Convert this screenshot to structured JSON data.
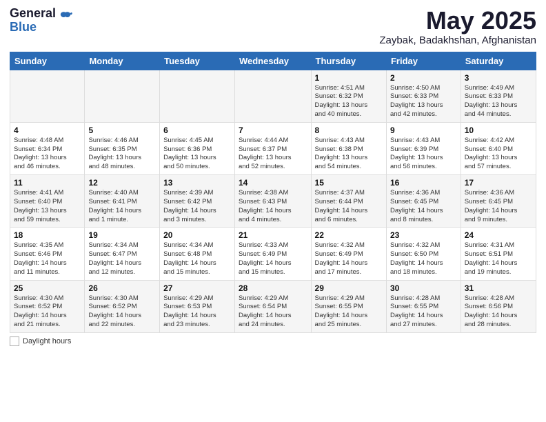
{
  "header": {
    "logo_general": "General",
    "logo_blue": "Blue",
    "month_title": "May 2025",
    "location": "Zaybak, Badakhshan, Afghanistan"
  },
  "weekdays": [
    "Sunday",
    "Monday",
    "Tuesday",
    "Wednesday",
    "Thursday",
    "Friday",
    "Saturday"
  ],
  "weeks": [
    [
      {
        "day": "",
        "info": ""
      },
      {
        "day": "",
        "info": ""
      },
      {
        "day": "",
        "info": ""
      },
      {
        "day": "",
        "info": ""
      },
      {
        "day": "1",
        "info": "Sunrise: 4:51 AM\nSunset: 6:32 PM\nDaylight: 13 hours\nand 40 minutes."
      },
      {
        "day": "2",
        "info": "Sunrise: 4:50 AM\nSunset: 6:33 PM\nDaylight: 13 hours\nand 42 minutes."
      },
      {
        "day": "3",
        "info": "Sunrise: 4:49 AM\nSunset: 6:33 PM\nDaylight: 13 hours\nand 44 minutes."
      }
    ],
    [
      {
        "day": "4",
        "info": "Sunrise: 4:48 AM\nSunset: 6:34 PM\nDaylight: 13 hours\nand 46 minutes."
      },
      {
        "day": "5",
        "info": "Sunrise: 4:46 AM\nSunset: 6:35 PM\nDaylight: 13 hours\nand 48 minutes."
      },
      {
        "day": "6",
        "info": "Sunrise: 4:45 AM\nSunset: 6:36 PM\nDaylight: 13 hours\nand 50 minutes."
      },
      {
        "day": "7",
        "info": "Sunrise: 4:44 AM\nSunset: 6:37 PM\nDaylight: 13 hours\nand 52 minutes."
      },
      {
        "day": "8",
        "info": "Sunrise: 4:43 AM\nSunset: 6:38 PM\nDaylight: 13 hours\nand 54 minutes."
      },
      {
        "day": "9",
        "info": "Sunrise: 4:43 AM\nSunset: 6:39 PM\nDaylight: 13 hours\nand 56 minutes."
      },
      {
        "day": "10",
        "info": "Sunrise: 4:42 AM\nSunset: 6:40 PM\nDaylight: 13 hours\nand 57 minutes."
      }
    ],
    [
      {
        "day": "11",
        "info": "Sunrise: 4:41 AM\nSunset: 6:40 PM\nDaylight: 13 hours\nand 59 minutes."
      },
      {
        "day": "12",
        "info": "Sunrise: 4:40 AM\nSunset: 6:41 PM\nDaylight: 14 hours\nand 1 minute."
      },
      {
        "day": "13",
        "info": "Sunrise: 4:39 AM\nSunset: 6:42 PM\nDaylight: 14 hours\nand 3 minutes."
      },
      {
        "day": "14",
        "info": "Sunrise: 4:38 AM\nSunset: 6:43 PM\nDaylight: 14 hours\nand 4 minutes."
      },
      {
        "day": "15",
        "info": "Sunrise: 4:37 AM\nSunset: 6:44 PM\nDaylight: 14 hours\nand 6 minutes."
      },
      {
        "day": "16",
        "info": "Sunrise: 4:36 AM\nSunset: 6:45 PM\nDaylight: 14 hours\nand 8 minutes."
      },
      {
        "day": "17",
        "info": "Sunrise: 4:36 AM\nSunset: 6:45 PM\nDaylight: 14 hours\nand 9 minutes."
      }
    ],
    [
      {
        "day": "18",
        "info": "Sunrise: 4:35 AM\nSunset: 6:46 PM\nDaylight: 14 hours\nand 11 minutes."
      },
      {
        "day": "19",
        "info": "Sunrise: 4:34 AM\nSunset: 6:47 PM\nDaylight: 14 hours\nand 12 minutes."
      },
      {
        "day": "20",
        "info": "Sunrise: 4:34 AM\nSunset: 6:48 PM\nDaylight: 14 hours\nand 15 minutes."
      },
      {
        "day": "21",
        "info": "Sunrise: 4:33 AM\nSunset: 6:49 PM\nDaylight: 14 hours\nand 15 minutes."
      },
      {
        "day": "22",
        "info": "Sunrise: 4:32 AM\nSunset: 6:49 PM\nDaylight: 14 hours\nand 17 minutes."
      },
      {
        "day": "23",
        "info": "Sunrise: 4:32 AM\nSunset: 6:50 PM\nDaylight: 14 hours\nand 18 minutes."
      },
      {
        "day": "24",
        "info": "Sunrise: 4:31 AM\nSunset: 6:51 PM\nDaylight: 14 hours\nand 19 minutes."
      }
    ],
    [
      {
        "day": "25",
        "info": "Sunrise: 4:30 AM\nSunset: 6:52 PM\nDaylight: 14 hours\nand 21 minutes."
      },
      {
        "day": "26",
        "info": "Sunrise: 4:30 AM\nSunset: 6:52 PM\nDaylight: 14 hours\nand 22 minutes."
      },
      {
        "day": "27",
        "info": "Sunrise: 4:29 AM\nSunset: 6:53 PM\nDaylight: 14 hours\nand 23 minutes."
      },
      {
        "day": "28",
        "info": "Sunrise: 4:29 AM\nSunset: 6:54 PM\nDaylight: 14 hours\nand 24 minutes."
      },
      {
        "day": "29",
        "info": "Sunrise: 4:29 AM\nSunset: 6:55 PM\nDaylight: 14 hours\nand 25 minutes."
      },
      {
        "day": "30",
        "info": "Sunrise: 4:28 AM\nSunset: 6:55 PM\nDaylight: 14 hours\nand 27 minutes."
      },
      {
        "day": "31",
        "info": "Sunrise: 4:28 AM\nSunset: 6:56 PM\nDaylight: 14 hours\nand 28 minutes."
      }
    ]
  ],
  "footer": {
    "daylight_label": "Daylight hours"
  }
}
